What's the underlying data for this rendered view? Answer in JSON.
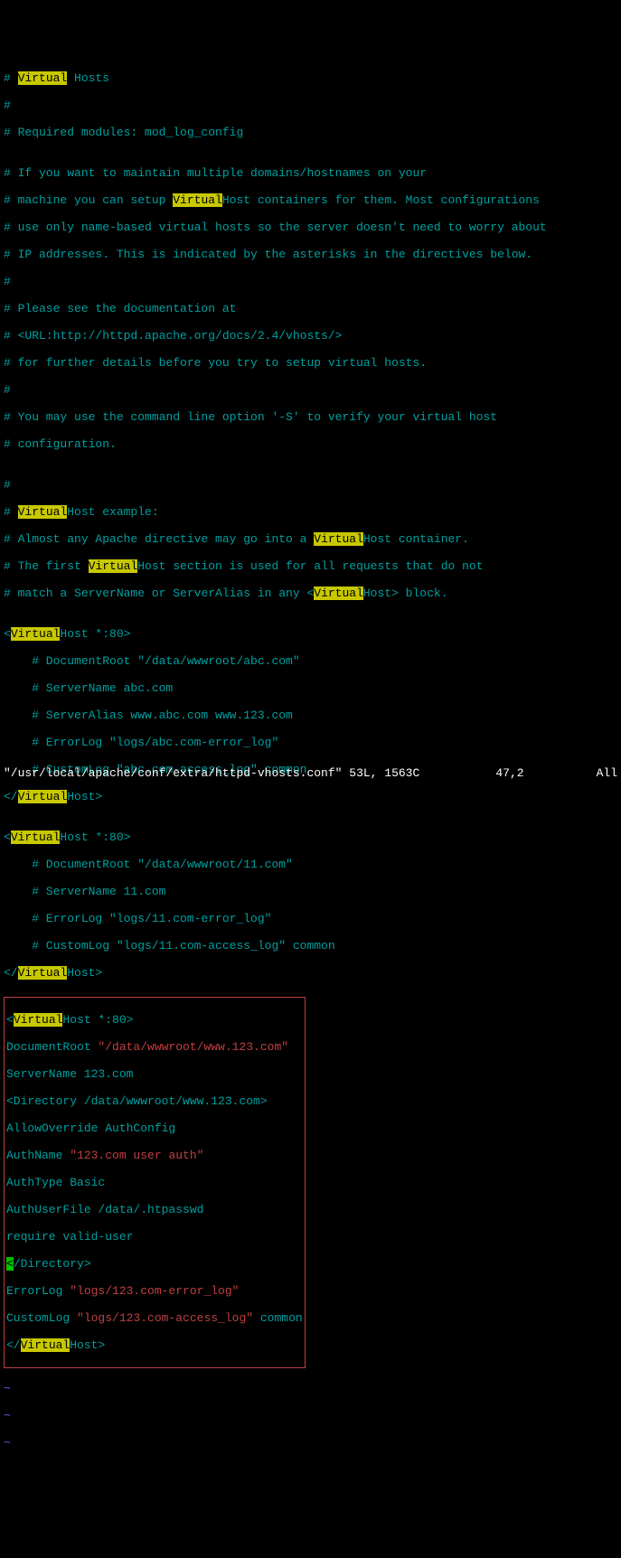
{
  "lines": {
    "l1a": "# ",
    "l1b": "Virtual",
    "l1c": " Hosts",
    "l2": "#",
    "l3": "# Required modules: mod_log_config",
    "l4": "",
    "l5": "# If you want to maintain multiple domains/hostnames on your",
    "l6a": "# machine you can setup ",
    "l6b": "Virtual",
    "l6c": "Host containers for them. Most configurations",
    "l7": "# use only name-based virtual hosts so the server doesn't need to worry about",
    "l8": "# IP addresses. This is indicated by the asterisks in the directives below.",
    "l9": "#",
    "l10": "# Please see the documentation at",
    "l11": "# <URL:http://httpd.apache.org/docs/2.4/vhosts/>",
    "l12": "# for further details before you try to setup virtual hosts.",
    "l13": "#",
    "l14": "# You may use the command line option '-S' to verify your virtual host",
    "l15": "# configuration.",
    "l16": "",
    "l17": "#",
    "l18a": "# ",
    "l18b": "Virtual",
    "l18c": "Host example:",
    "l19a": "# Almost any Apache directive may go into a ",
    "l19b": "Virtual",
    "l19c": "Host container.",
    "l20a": "# The first ",
    "l20b": "Virtual",
    "l20c": "Host section is used for all requests that do not",
    "l21a": "# match a ServerName or ServerAlias in any <",
    "l21b": "Virtual",
    "l21c": "Host> block.",
    "l22": "",
    "l23a": "<",
    "l23b": "Virtual",
    "l23c": "Host *:80>",
    "l24": "    # DocumentRoot \"/data/wwwroot/abc.com\"",
    "l25": "    # ServerName abc.com",
    "l26": "    # ServerAlias www.abc.com www.123.com",
    "l27": "    # ErrorLog \"logs/abc.com-error_log\"",
    "l28": "    # CustomLog \"abc.com-access_log\" common",
    "l29a": "</",
    "l29b": "Virtual",
    "l29c": "Host>",
    "l30": "",
    "l31a": "<",
    "l31b": "Virtual",
    "l31c": "Host *:80>",
    "l32": "    # DocumentRoot \"/data/wwwroot/11.com\"",
    "l33": "    # ServerName 11.com",
    "l34": "    # ErrorLog \"logs/11.com-error_log\"",
    "l35": "    # CustomLog \"logs/11.com-access_log\" common",
    "l36a": "</",
    "l36b": "Virtual",
    "l36c": "Host>",
    "b1a": "<",
    "b1b": "Virtual",
    "b1c": "Host *:80>",
    "b2a": "DocumentRoot ",
    "b2b": "\"/data/wwwroot/www.123.com\"",
    "b3": "ServerName 123.com",
    "b4": "<Directory /data/wwwroot/www.123.com>",
    "b5": "AllowOverride AuthConfig",
    "b6a": "AuthName ",
    "b6b": "\"123.com user auth\"",
    "b7": "AuthType Basic",
    "b8": "AuthUserFile /data/.htpasswd",
    "b9": "require valid-user",
    "b10a": "<",
    "b10b": "/Directory>",
    "b11a": "ErrorLog ",
    "b11b": "\"logs/123.com-error_log\"",
    "b12a": "CustomLog ",
    "b12b": "\"logs/123.com-access_log\"",
    "b12c": " common",
    "b13a": "</",
    "b13b": "Virtual",
    "b13c": "Host>",
    "tilde": "~"
  },
  "status": {
    "filepath": "\"/usr/local/apache/conf/extra/httpd-vhosts.conf\" 53L, 1563C",
    "position": "47,2",
    "scroll": "All"
  }
}
